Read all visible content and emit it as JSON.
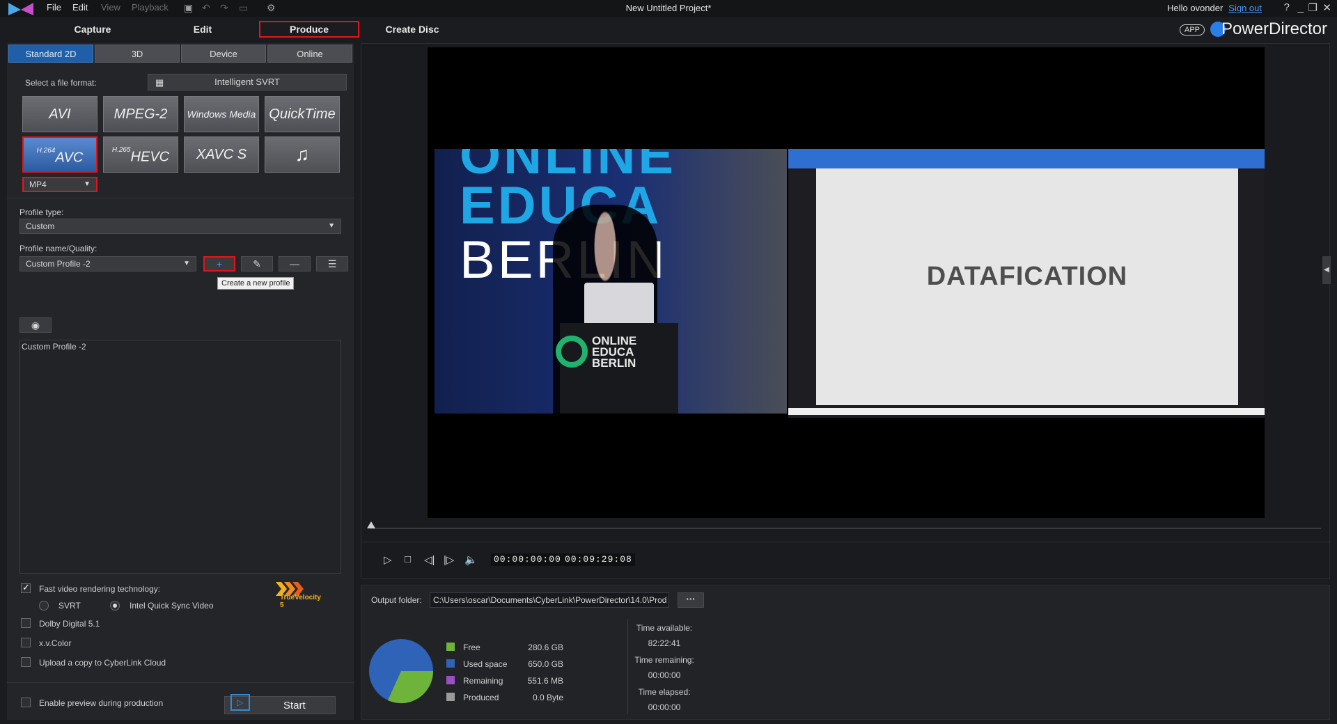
{
  "menu": {
    "file": "File",
    "edit": "Edit",
    "view": "View",
    "playback": "Playback"
  },
  "window": {
    "title": "New Untitled Project*",
    "greeting": "Hello ovonder",
    "sign_out": "Sign out"
  },
  "main_tabs": {
    "capture": "Capture",
    "edit": "Edit",
    "produce": "Produce",
    "create_disc": "Create Disc"
  },
  "brand": {
    "app_badge": "APP",
    "name": "PowerDirector"
  },
  "produce": {
    "tabs": [
      "Standard 2D",
      "3D",
      "Device",
      "Online"
    ],
    "file_format_label": "Select a file format:",
    "svrt_button": "Intelligent SVRT",
    "formats": {
      "avi": "AVI",
      "mpeg2": "MPEG-2",
      "wmv": "Windows Media",
      "quicktime": "QuickTime",
      "avc_prefix": "H.264",
      "avc": "AVC",
      "hevc_prefix": "H.265",
      "hevc": "HEVC",
      "xavcs": "XAVC S",
      "audio": "♫"
    },
    "container": "MP4",
    "profile_type_label": "Profile type:",
    "profile_type": "Custom",
    "profile_name_label": "Profile name/Quality:",
    "profile_name": "Custom Profile -2",
    "tooltip": "Create a new profile",
    "profile_description": "Custom Profile -2",
    "fast_render_label": "Fast video rendering technology:",
    "svrt_option": "SVRT",
    "quick_sync_option": "Intel Quick Sync Video",
    "dolby": "Dolby Digital 5.1",
    "xvcolor": "x.v.Color",
    "upload_cloud": "Upload a copy to CyberLink Cloud",
    "enable_preview": "Enable preview during production",
    "start": "Start",
    "truevelocity": "TrueVelocity 5"
  },
  "preview": {
    "slide_title": "DATAFICATION",
    "stage_line1": "ONLINE",
    "stage_line2": "EDUCA",
    "stage_line3": "BERLIN",
    "podium_line1": "ONLINE",
    "podium_line2": "EDUCA",
    "podium_line3": "BERLIN",
    "current_time": "00:00:00:00",
    "total_time": "00:09:29:08"
  },
  "output": {
    "folder_label": "Output folder:",
    "folder_path": "C:\\Users\\oscar\\Documents\\CyberLink\\PowerDirector\\14.0\\Prod",
    "browse": "···",
    "legend": [
      {
        "label": "Free",
        "value": "280.6 GB",
        "color": "#6fb43a"
      },
      {
        "label": "Used space",
        "value": "650.0 GB",
        "color": "#2e63b8"
      },
      {
        "label": "Remaining",
        "value": "551.6 MB",
        "color": "#9b4fc6"
      },
      {
        "label": "Produced",
        "value": "0.0 Byte",
        "color": "#9a9a9a"
      }
    ],
    "time_available_label": "Time available:",
    "time_available": "82:22:41",
    "time_remaining_label": "Time remaining:",
    "time_remaining": "00:00:00",
    "time_elapsed_label": "Time elapsed:",
    "time_elapsed": "00:00:00"
  }
}
